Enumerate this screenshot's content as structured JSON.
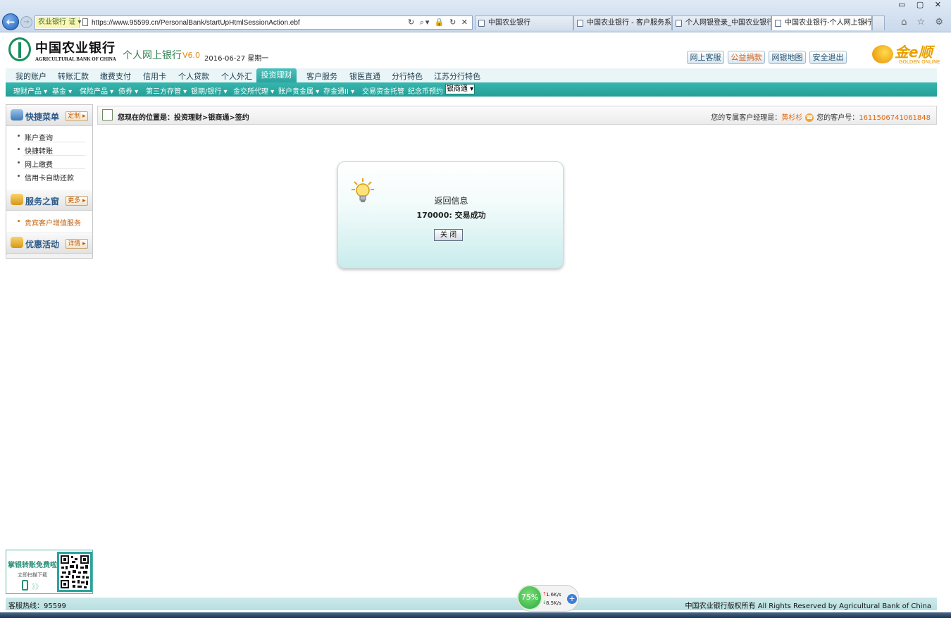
{
  "browser": {
    "site_badge": "农业银行",
    "site_badge_suffix": "证",
    "url": "https://www.95599.cn/PersonalBank/startUpHtmlSessionAction.ebf",
    "tabs": [
      {
        "label": "中国农业银行"
      },
      {
        "label": "中国农业银行 - 客户服务系统"
      },
      {
        "label": "个人网银登录_中国农业银行"
      },
      {
        "label": "中国农业银行-个人网上银行"
      }
    ],
    "tab_close": "×"
  },
  "header": {
    "logo_cn": "中国农业银行",
    "logo_en": "AGRICULTURAL BANK OF CHINA",
    "product_name": "个人网上银行",
    "product_version": "V6.0",
    "date": "2016-06-27 星期一",
    "buttons": [
      {
        "label": "网上客服"
      },
      {
        "label": "公益捐款"
      },
      {
        "label": "网银地图"
      },
      {
        "label": "安全退出"
      }
    ],
    "golden_cn": "金e顺",
    "golden_en": "GOLDEN ONLINE"
  },
  "nav": {
    "primary": [
      {
        "label": "我的账户"
      },
      {
        "label": "转账汇款"
      },
      {
        "label": "缴费支付"
      },
      {
        "label": "信用卡"
      },
      {
        "label": "个人贷款"
      },
      {
        "label": "个人外汇"
      },
      {
        "label": "投资理财"
      },
      {
        "label": "客户服务"
      },
      {
        "label": "银医直通"
      },
      {
        "label": "分行特色"
      },
      {
        "label": "江苏分行特色"
      }
    ],
    "secondary": [
      {
        "label": "理财产品 ▾"
      },
      {
        "label": "基金 ▾"
      },
      {
        "label": "保险产品 ▾"
      },
      {
        "label": "债券 ▾"
      },
      {
        "label": "第三方存管 ▾"
      },
      {
        "label": "银期/银行 ▾"
      },
      {
        "label": "金交所代理 ▾"
      },
      {
        "label": "账户贵金属 ▾"
      },
      {
        "label": "存金通II ▾"
      },
      {
        "label": "交易资金托管"
      },
      {
        "label": "纪念币预约"
      },
      {
        "label": "银商通 ▾"
      }
    ]
  },
  "sidebar": {
    "quick_menu": {
      "title": "快捷菜单",
      "button": "定制 ▸",
      "items": [
        {
          "label": "账户查询"
        },
        {
          "label": "快捷转账"
        },
        {
          "label": "网上缴费"
        },
        {
          "label": "信用卡自助还款"
        }
      ]
    },
    "service": {
      "title": "服务之窗",
      "button": "更多 ▸",
      "items": [
        {
          "label": "贵宾客户增值服务"
        }
      ]
    },
    "promo": {
      "title": "优惠活动",
      "button": "详情 ▸"
    }
  },
  "breadcrumb": {
    "text": "您现在的位置是：投资理财>银商通>签约",
    "manager_label": "您的专属客户经理是：",
    "manager_name": "黄杉杉",
    "customer_label": "您的客户号：",
    "customer_no": "1611506741061848"
  },
  "dialog": {
    "title": "返回信息",
    "message": "170000: 交易成功",
    "close_button": "关 闭"
  },
  "qr_promo": {
    "line1": "掌银转账免费啦",
    "line2": "立即扫描下载",
    "arrows": "》》"
  },
  "footer": {
    "hotline": "客服热线：95599",
    "copyright": "中国农业银行版权所有  All Rights Reserved by Agricultural Bank of China"
  },
  "speed_widget": {
    "percent": "75%",
    "upload": "1.6K/s",
    "download": "8.5K/s"
  },
  "colors": {
    "teal_nav": "#2aa39e",
    "brand_green": "#1a8e5b",
    "accent_orange": "#e06a10"
  }
}
